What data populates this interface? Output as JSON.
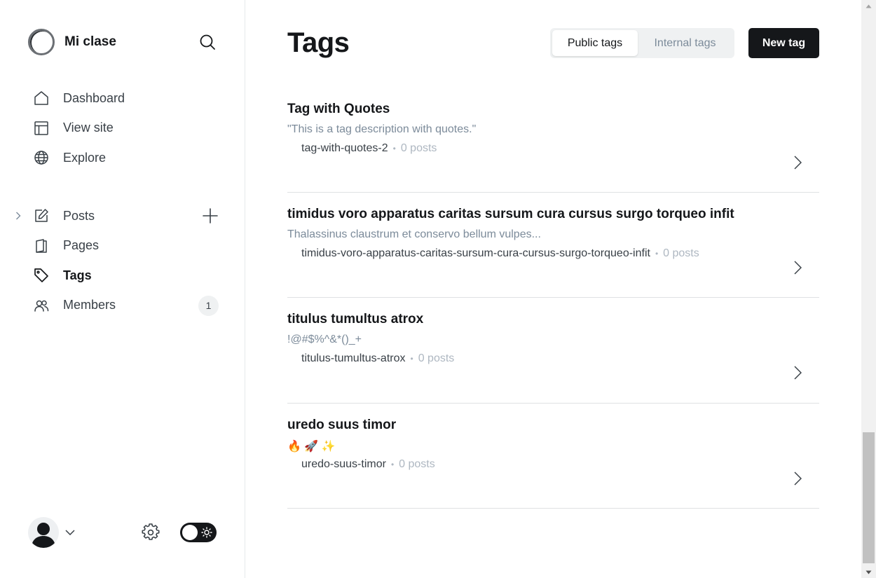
{
  "app": {
    "site_name": "Mi clase"
  },
  "sidebar": {
    "top_nav": [
      {
        "label": "Dashboard",
        "icon": "home-icon"
      },
      {
        "label": "View site",
        "icon": "layout-icon"
      },
      {
        "label": "Explore",
        "icon": "globe-icon"
      }
    ],
    "main_nav": [
      {
        "label": "Posts",
        "icon": "pen-icon"
      },
      {
        "label": "Pages",
        "icon": "page-icon"
      },
      {
        "label": "Tags",
        "icon": "tag-icon",
        "active": true
      },
      {
        "label": "Members",
        "icon": "members-icon",
        "badge": "1"
      }
    ]
  },
  "header": {
    "title": "Tags",
    "segments": [
      "Public tags",
      "Internal tags"
    ],
    "active_segment": "Public tags",
    "new_button": "New tag"
  },
  "tags": [
    {
      "name": "Tag with Quotes",
      "description": "\"This is a tag description with quotes.\"",
      "slug": "tag-with-quotes-2",
      "separator": "•",
      "count": "0 posts"
    },
    {
      "name": "timidus voro apparatus caritas sursum cura cursus surgo torqueo infit",
      "description": "Thalassinus claustrum et conservo bellum vulpes...",
      "slug": "timidus-voro-apparatus-caritas-sursum-cura-cursus-surgo-torqueo-infit",
      "separator": "•",
      "count": "0 posts"
    },
    {
      "name": "titulus tumultus atrox",
      "description": "!@#$%^&*()_+",
      "slug": "titulus-tumultus-atrox",
      "separator": "•",
      "count": "0 posts"
    },
    {
      "name": "uredo suus timor",
      "description": "🔥 🚀 ✨",
      "slug": "uredo-suus-timor",
      "separator": "•",
      "count": "0 posts"
    }
  ],
  "colors": {
    "text_primary": "#15171a",
    "text_muted": "#7c8b9a",
    "button_dark": "#15171a",
    "divider": "#dfe1e3"
  }
}
